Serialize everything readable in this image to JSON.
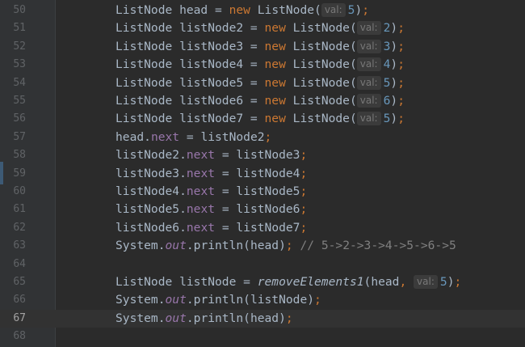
{
  "editor": {
    "lines": [
      {
        "no": "50",
        "tokens": [
          [
            "",
            "ListNode head = "
          ],
          [
            "kw",
            "new "
          ],
          [
            "",
            "ListNode("
          ],
          [
            "hint",
            "val:"
          ],
          [
            "num",
            "5"
          ],
          [
            "",
            ")"
          ],
          [
            "kw",
            ";"
          ]
        ]
      },
      {
        "no": "51",
        "tokens": [
          [
            "",
            "ListNode listNode2 = "
          ],
          [
            "kw",
            "new "
          ],
          [
            "",
            "ListNode("
          ],
          [
            "hint",
            "val:"
          ],
          [
            "num",
            "2"
          ],
          [
            "",
            ")"
          ],
          [
            "kw",
            ";"
          ]
        ]
      },
      {
        "no": "52",
        "tokens": [
          [
            "",
            "ListNode listNode3 = "
          ],
          [
            "kw",
            "new "
          ],
          [
            "",
            "ListNode("
          ],
          [
            "hint",
            "val:"
          ],
          [
            "num",
            "3"
          ],
          [
            "",
            ")"
          ],
          [
            "kw",
            ";"
          ]
        ]
      },
      {
        "no": "53",
        "tokens": [
          [
            "",
            "ListNode listNode4 = "
          ],
          [
            "kw",
            "new "
          ],
          [
            "",
            "ListNode("
          ],
          [
            "hint",
            "val:"
          ],
          [
            "num",
            "4"
          ],
          [
            "",
            ")"
          ],
          [
            "kw",
            ";"
          ]
        ]
      },
      {
        "no": "54",
        "tokens": [
          [
            "",
            "ListNode listNode5 = "
          ],
          [
            "kw",
            "new "
          ],
          [
            "",
            "ListNode("
          ],
          [
            "hint",
            "val:"
          ],
          [
            "num",
            "5"
          ],
          [
            "",
            ")"
          ],
          [
            "kw",
            ";"
          ]
        ]
      },
      {
        "no": "55",
        "tokens": [
          [
            "",
            "ListNode listNode6 = "
          ],
          [
            "kw",
            "new "
          ],
          [
            "",
            "ListNode("
          ],
          [
            "hint",
            "val:"
          ],
          [
            "num",
            "6"
          ],
          [
            "",
            ")"
          ],
          [
            "kw",
            ";"
          ]
        ]
      },
      {
        "no": "56",
        "tokens": [
          [
            "",
            "ListNode listNode7 = "
          ],
          [
            "kw",
            "new "
          ],
          [
            "",
            "ListNode("
          ],
          [
            "hint",
            "val:"
          ],
          [
            "num",
            "5"
          ],
          [
            "",
            ")"
          ],
          [
            "kw",
            ";"
          ]
        ]
      },
      {
        "no": "57",
        "tokens": [
          [
            "",
            "head."
          ],
          [
            "fld",
            "next"
          ],
          [
            "",
            " = listNode2"
          ],
          [
            "kw",
            ";"
          ]
        ]
      },
      {
        "no": "58",
        "tokens": [
          [
            "",
            "listNode2."
          ],
          [
            "fld",
            "next"
          ],
          [
            "",
            " = listNode3"
          ],
          [
            "kw",
            ";"
          ]
        ]
      },
      {
        "no": "59",
        "tokens": [
          [
            "",
            "listNode3."
          ],
          [
            "fld",
            "next"
          ],
          [
            "",
            " = listNode4"
          ],
          [
            "kw",
            ";"
          ]
        ]
      },
      {
        "no": "60",
        "tokens": [
          [
            "",
            "listNode4."
          ],
          [
            "fld",
            "next"
          ],
          [
            "",
            " = listNode5"
          ],
          [
            "kw",
            ";"
          ]
        ]
      },
      {
        "no": "61",
        "tokens": [
          [
            "",
            "listNode5."
          ],
          [
            "fld",
            "next"
          ],
          [
            "",
            " = listNode6"
          ],
          [
            "kw",
            ";"
          ]
        ]
      },
      {
        "no": "62",
        "tokens": [
          [
            "",
            "listNode6."
          ],
          [
            "fld",
            "next"
          ],
          [
            "",
            " = listNode7"
          ],
          [
            "kw",
            ";"
          ]
        ]
      },
      {
        "no": "63",
        "tokens": [
          [
            "",
            "System."
          ],
          [
            "sfld",
            "out"
          ],
          [
            "",
            ".println(head)"
          ],
          [
            "kw",
            ";"
          ],
          [
            "cmt",
            " // 5->2->3->4->5->6->5"
          ]
        ]
      },
      {
        "no": "64",
        "tokens": []
      },
      {
        "no": "65",
        "tokens": [
          [
            "",
            "ListNode listNode = "
          ],
          [
            "meth",
            "removeElements1"
          ],
          [
            "",
            "(head"
          ],
          [
            "kw",
            ", "
          ],
          [
            "hint",
            "val:"
          ],
          [
            "num",
            "5"
          ],
          [
            "",
            ")"
          ],
          [
            "kw",
            ";"
          ]
        ]
      },
      {
        "no": "66",
        "tokens": [
          [
            "",
            "System."
          ],
          [
            "sfld",
            "out"
          ],
          [
            "",
            ".println(listNode)"
          ],
          [
            "kw",
            ";"
          ]
        ]
      },
      {
        "no": "67",
        "current": true,
        "tokens": [
          [
            "",
            "System."
          ],
          [
            "sfld",
            "out"
          ],
          [
            "",
            ".println(head)"
          ],
          [
            "kw",
            ";"
          ]
        ]
      },
      {
        "no": "68",
        "tokens": []
      }
    ]
  },
  "colors": {
    "background": "#2b2b2b",
    "keyword": "#cc7832",
    "field": "#9876aa",
    "number": "#6897bb",
    "comment": "#808080",
    "text": "#a9b7c6"
  }
}
